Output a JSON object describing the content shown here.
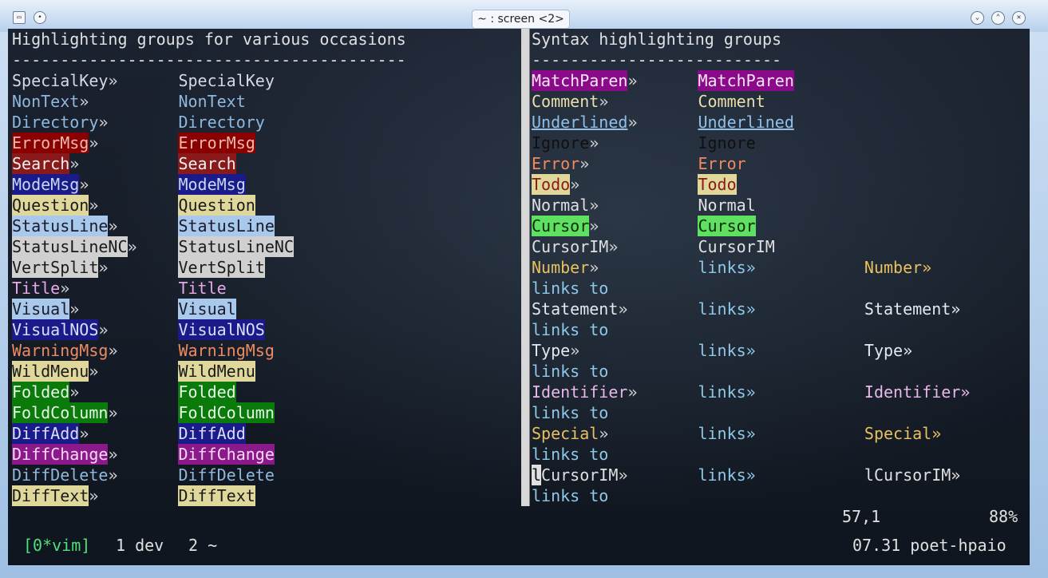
{
  "window": {
    "title": "~ : screen <2>",
    "menu_icon": "terminal-icon",
    "pin_icon": "pin-icon",
    "buttons": [
      "minimize",
      "maximize",
      "close"
    ]
  },
  "left_pane": {
    "header": "Highlighting groups for various occasions",
    "rule": "-----------------------------------------",
    "groups": [
      {
        "name": "SpecialKey",
        "fg": "#d7d7e8",
        "bg": ""
      },
      {
        "name": "NonText",
        "fg": "#8fb8dc",
        "bg": ""
      },
      {
        "name": "Directory",
        "fg": "#8fb8dc",
        "bg": ""
      },
      {
        "name": "ErrorMsg",
        "fg": "#f0b8a8",
        "bg": "#8a0000"
      },
      {
        "name": "Search",
        "fg": "#f0f0f0",
        "bg": "#8a1a1a"
      },
      {
        "name": "ModeMsg",
        "fg": "#c8d8f0",
        "bg": "#1a1a8a"
      },
      {
        "name": "Question",
        "fg": "#1a1a1a",
        "bg": "#e0d89a"
      },
      {
        "name": "StatusLine",
        "fg": "#1a1a2a",
        "bg": "#a8c8ec"
      },
      {
        "name": "StatusLineNC",
        "fg": "#1a1a1a",
        "bg": "#d0d0d0"
      },
      {
        "name": "VertSplit",
        "fg": "#1a1a1a",
        "bg": "#d0d0d0"
      },
      {
        "name": "Title",
        "fg": "#e8a8e8",
        "bg": ""
      },
      {
        "name": "Visual",
        "fg": "#1a1a2a",
        "bg": "#a8c8ec"
      },
      {
        "name": "VisualNOS",
        "fg": "#d8e0f8",
        "bg": "#1a1a8a"
      },
      {
        "name": "WarningMsg",
        "fg": "#f08a60",
        "bg": ""
      },
      {
        "name": "WildMenu",
        "fg": "#1a1a1a",
        "bg": "#e0d89a"
      },
      {
        "name": "Folded",
        "fg": "#e8f8e8",
        "bg": "#0a7a0a"
      },
      {
        "name": "FoldColumn",
        "fg": "#e8f8e8",
        "bg": "#0a7a0a"
      },
      {
        "name": "DiffAdd",
        "fg": "#d8e0f8",
        "bg": "#1a1a8a"
      },
      {
        "name": "DiffChange",
        "fg": "#f8d8f8",
        "bg": "#8a1a8a"
      },
      {
        "name": "DiffDelete",
        "fg": "#8fb8dc",
        "bg": ""
      },
      {
        "name": "DiffText",
        "fg": "#1a1a1a",
        "bg": "#e0d89a"
      }
    ],
    "marker": "»"
  },
  "right_pane": {
    "header": "Syntax highlighting groups",
    "rule": "--------------------------",
    "groups": [
      {
        "name": "MatchParen",
        "fg": "#f8e8f8",
        "bg": "#8a0a8a"
      },
      {
        "name": "Comment",
        "fg": "#e8e0a8",
        "bg": ""
      },
      {
        "name": "Underlined",
        "fg": "#8fc0e8",
        "bg": "",
        "underline": true
      },
      {
        "name": "Ignore",
        "fg": "#101010",
        "bg": ""
      },
      {
        "name": "Error",
        "fg": "#f08a60",
        "bg": ""
      },
      {
        "name": "Todo",
        "fg": "#8a1a1a",
        "bg": "#e0d89a"
      },
      {
        "name": "Normal",
        "fg": "#e0e0e0",
        "bg": ""
      },
      {
        "name": "Cursor",
        "fg": "#0a2a0a",
        "bg": "#60e060"
      },
      {
        "name": "CursorIM",
        "fg": "#e0e0e0",
        "bg": ""
      }
    ],
    "links": [
      {
        "name": "Number",
        "fg": "#e8c060",
        "target": "Number»"
      },
      {
        "name": "Statement",
        "fg": "#e0e8f0",
        "target": "Statement»"
      },
      {
        "name": "Type",
        "fg": "#e0e8f0",
        "target": "Type»"
      },
      {
        "name": "Identifier",
        "fg": "#e8b8e8",
        "target": "Identifier»"
      },
      {
        "name": "Special",
        "fg": "#e8c060",
        "target": "Special»"
      },
      {
        "name": "lCursorIM",
        "fg": "#e0e0e0",
        "target": "lCursorIM»",
        "cursor_first": true
      }
    ],
    "links_word": "links»",
    "links_to": "links to",
    "links_color": "#8fc8e8"
  },
  "statusline": {
    "position": "57,1",
    "percent": "88%"
  },
  "screen_bar": {
    "current": "[0*vim]",
    "win1": "1 dev",
    "win2": "2 ~",
    "right": "07.31 poet-hpaio",
    "current_color": "#4ee07a"
  }
}
